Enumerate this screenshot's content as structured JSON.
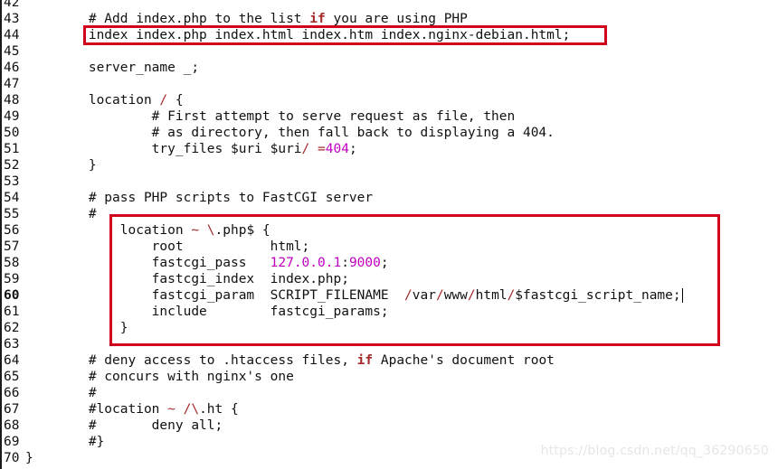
{
  "editor": {
    "lines": [
      {
        "n": "42",
        "parts": [
          {
            "t": ""
          }
        ]
      },
      {
        "n": "43",
        "parts": [
          {
            "t": "        # Add index.php to the list "
          },
          {
            "t": "if",
            "c": "kw"
          },
          {
            "t": " you are using PHP"
          }
        ]
      },
      {
        "n": "44",
        "parts": [
          {
            "t": "        index index.php index.html index.htm index.nginx-debian.html;"
          }
        ]
      },
      {
        "n": "45",
        "parts": [
          {
            "t": ""
          }
        ]
      },
      {
        "n": "46",
        "parts": [
          {
            "t": "        server_name _;"
          }
        ]
      },
      {
        "n": "47",
        "parts": [
          {
            "t": ""
          }
        ]
      },
      {
        "n": "48",
        "parts": [
          {
            "t": "        location "
          },
          {
            "t": "/",
            "c": "op"
          },
          {
            "t": " {"
          }
        ]
      },
      {
        "n": "49",
        "parts": [
          {
            "t": "                # First attempt to serve request as file, then"
          }
        ]
      },
      {
        "n": "50",
        "parts": [
          {
            "t": "                # as directory, then fall back to displaying a 404."
          }
        ]
      },
      {
        "n": "51",
        "parts": [
          {
            "t": "                try_files $uri $uri"
          },
          {
            "t": "/",
            "c": "op"
          },
          {
            "t": " "
          },
          {
            "t": "=",
            "c": "op"
          },
          {
            "t": "404",
            "c": "mag"
          },
          {
            "t": ";"
          }
        ]
      },
      {
        "n": "52",
        "parts": [
          {
            "t": "        }"
          }
        ]
      },
      {
        "n": "53",
        "parts": [
          {
            "t": ""
          }
        ]
      },
      {
        "n": "54",
        "parts": [
          {
            "t": "        # pass PHP scripts to FastCGI server"
          }
        ]
      },
      {
        "n": "55",
        "parts": [
          {
            "t": "        #"
          }
        ]
      },
      {
        "n": "56",
        "parts": [
          {
            "t": "            location "
          },
          {
            "t": "~",
            "c": "op"
          },
          {
            "t": " "
          },
          {
            "t": "\\",
            "c": "op"
          },
          {
            "t": ".php$ {"
          }
        ]
      },
      {
        "n": "57",
        "parts": [
          {
            "t": "                root           html;"
          }
        ]
      },
      {
        "n": "58",
        "parts": [
          {
            "t": "                fastcgi_pass   "
          },
          {
            "t": "127.0.0.1",
            "c": "mag"
          },
          {
            "t": ":"
          },
          {
            "t": "9000",
            "c": "mag"
          },
          {
            "t": ";"
          }
        ]
      },
      {
        "n": "59",
        "parts": [
          {
            "t": "                fastcgi_index  index.php;"
          }
        ]
      },
      {
        "n": "60",
        "cur": true,
        "parts": [
          {
            "t": "                fastcgi_param  SCRIPT_FILENAME  "
          },
          {
            "t": "/",
            "c": "op"
          },
          {
            "t": "var"
          },
          {
            "t": "/",
            "c": "op"
          },
          {
            "t": "www"
          },
          {
            "t": "/",
            "c": "op"
          },
          {
            "t": "html"
          },
          {
            "t": "/",
            "c": "op"
          },
          {
            "t": "$fastcgi_script_name;"
          }
        ],
        "cursor": true
      },
      {
        "n": "61",
        "parts": [
          {
            "t": "                include        fastcgi_params;"
          }
        ]
      },
      {
        "n": "62",
        "parts": [
          {
            "t": "            }"
          }
        ]
      },
      {
        "n": "63",
        "parts": [
          {
            "t": ""
          }
        ]
      },
      {
        "n": "64",
        "parts": [
          {
            "t": "        # deny access to .htaccess files, "
          },
          {
            "t": "if",
            "c": "kw"
          },
          {
            "t": " Apache's document root"
          }
        ]
      },
      {
        "n": "65",
        "parts": [
          {
            "t": "        # concurs with nginx's one"
          }
        ]
      },
      {
        "n": "66",
        "parts": [
          {
            "t": "        #"
          }
        ]
      },
      {
        "n": "67",
        "parts": [
          {
            "t": "        #location "
          },
          {
            "t": "~",
            "c": "op"
          },
          {
            "t": " "
          },
          {
            "t": "/\\",
            "c": "op"
          },
          {
            "t": ".ht {"
          }
        ]
      },
      {
        "n": "68",
        "parts": [
          {
            "t": "        #       deny all;"
          }
        ]
      },
      {
        "n": "69",
        "parts": [
          {
            "t": "        #}"
          }
        ]
      },
      {
        "n": "70",
        "parts": [
          {
            "t": "}"
          }
        ]
      }
    ]
  },
  "watermark": "https://blog.csdn.net/qq_36290650"
}
